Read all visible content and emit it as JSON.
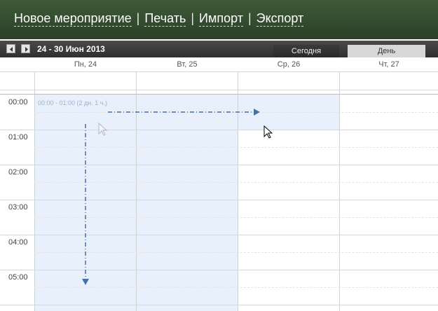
{
  "menu": {
    "new_event": "Новое мероприятие",
    "print": "Печать",
    "import": "Импорт",
    "export": "Экспорт",
    "separator": "|"
  },
  "toolbar": {
    "date_range": "24 - 30 Июн 2013",
    "today_button": "Сегодня",
    "day_button": "День"
  },
  "days": [
    {
      "label": "Пн, 24"
    },
    {
      "label": "Вт, 25"
    },
    {
      "label": "Ср, 26"
    },
    {
      "label": "Чт, 27"
    }
  ],
  "times": [
    "00:00",
    "01:00",
    "02:00",
    "03:00",
    "04:00",
    "05:00"
  ],
  "event": {
    "text": "00:00 - 01:00 (2 дн. 1 ч.)"
  },
  "colors": {
    "header": "#3d5a38",
    "selection": "#e8f0fb",
    "arrow": "#4a6fa5"
  }
}
